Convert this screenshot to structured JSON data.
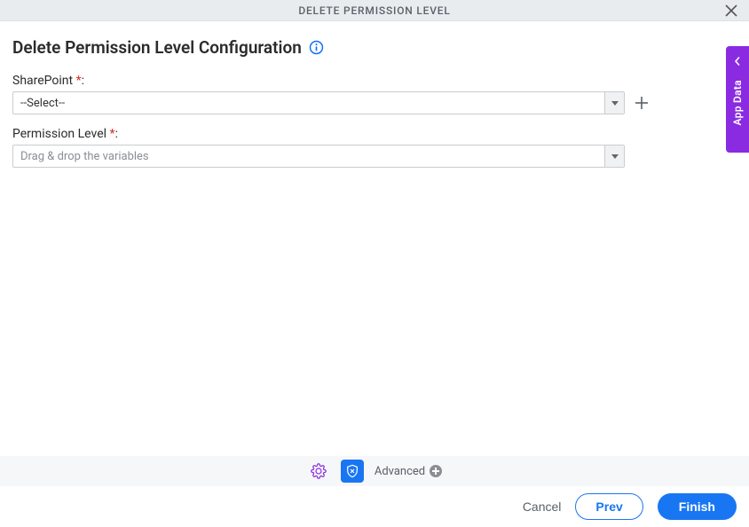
{
  "titlebar": {
    "title": "DELETE PERMISSION LEVEL"
  },
  "page": {
    "heading": "Delete Permission Level Configuration"
  },
  "fields": {
    "sharepoint": {
      "label": "SharePoint",
      "value": "--Select--"
    },
    "permission_level": {
      "label": "Permission Level",
      "placeholder": "Drag & drop the variables"
    }
  },
  "side_tab": {
    "label": "App Data"
  },
  "bottom_bar": {
    "advanced_label": "Advanced"
  },
  "footer": {
    "cancel": "Cancel",
    "prev": "Prev",
    "finish": "Finish"
  }
}
